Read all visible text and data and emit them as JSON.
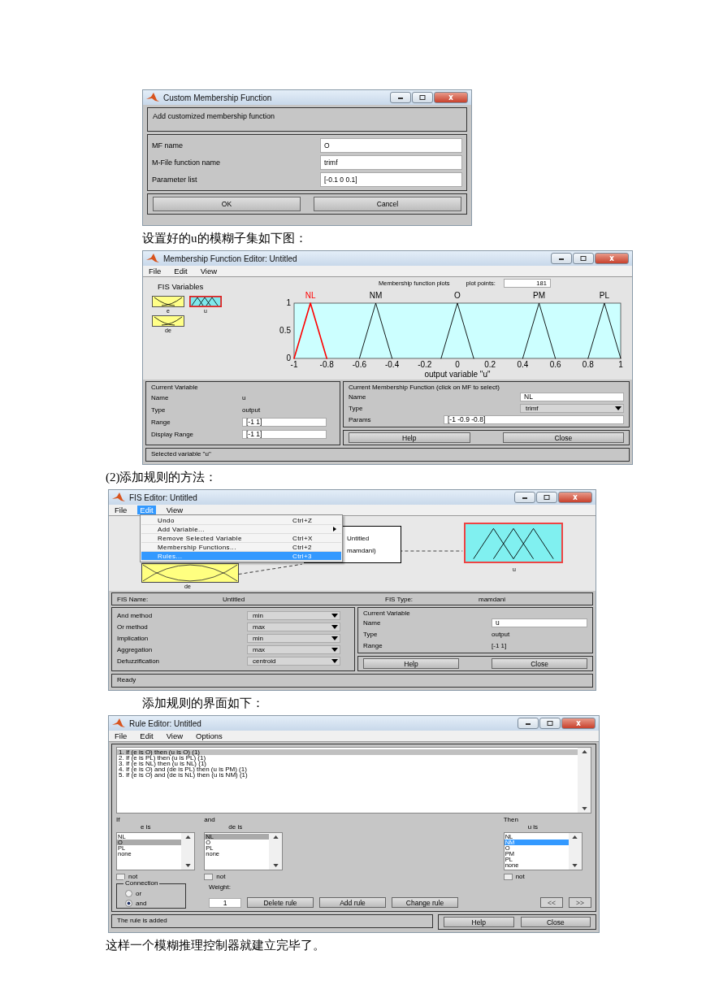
{
  "custom_mf_dialog": {
    "title": "Custom Membership Function",
    "header": "Add customized membership function",
    "fields": [
      {
        "label": "MF name",
        "value": "O"
      },
      {
        "label": "M-File function name",
        "value": "trimf"
      },
      {
        "label": "Parameter list",
        "value": "[-0.1 0 0.1]"
      }
    ],
    "buttons": [
      "OK",
      "Cancel"
    ]
  },
  "caption_1": "设置好的u的模糊子集如下图：",
  "mf_editor": {
    "title": "Membership Function Editor: Untitled",
    "menu": [
      {
        "label": "File",
        "selected": false
      },
      {
        "label": "Edit",
        "selected": false
      },
      {
        "label": "View",
        "selected": false
      }
    ],
    "variables_title": "FIS Variables",
    "variables": [
      {
        "name": "e",
        "kind": "input",
        "selected": false
      },
      {
        "name": "u",
        "kind": "output",
        "selected": true
      },
      {
        "name": "de",
        "kind": "input",
        "selected": false
      }
    ],
    "plot_points_label": "plot points:",
    "plot_points": "181",
    "chart_data": {
      "type": "line",
      "title": "Membership function plots",
      "xlabel": "output variable \"u\"",
      "x": [
        -1,
        -0.9,
        -0.8,
        -0.6,
        -0.5,
        -0.4,
        -0.1,
        0,
        0.1,
        0.4,
        0.5,
        0.6,
        0.8,
        0.9,
        1
      ],
      "series": [
        {
          "name": "NL",
          "color": "#ff0000",
          "values": [
            0,
            1,
            0,
            null,
            null,
            null,
            null,
            null,
            null,
            null,
            null,
            null,
            null,
            null,
            null
          ]
        },
        {
          "name": "NM",
          "color": "#000000",
          "values": [
            null,
            null,
            null,
            0,
            1,
            0,
            null,
            null,
            null,
            null,
            null,
            null,
            null,
            null,
            null
          ]
        },
        {
          "name": "O",
          "color": "#000000",
          "values": [
            null,
            null,
            null,
            null,
            null,
            null,
            0,
            1,
            0,
            null,
            null,
            null,
            null,
            null,
            null
          ]
        },
        {
          "name": "PM",
          "color": "#000000",
          "values": [
            null,
            null,
            null,
            null,
            null,
            null,
            null,
            null,
            null,
            0,
            1,
            0,
            null,
            null,
            null
          ]
        },
        {
          "name": "PL",
          "color": "#000000",
          "values": [
            null,
            null,
            null,
            null,
            null,
            null,
            null,
            null,
            null,
            null,
            null,
            null,
            0,
            1,
            0
          ]
        }
      ],
      "xlim": [
        -1,
        1
      ],
      "ylim": [
        0,
        1
      ],
      "xticks": [
        -1,
        -0.8,
        -0.6,
        -0.4,
        -0.2,
        0,
        0.2,
        0.4,
        0.6,
        0.8,
        1
      ],
      "yticks": [
        0,
        0.5,
        1
      ]
    },
    "current_variable": {
      "title": "Current Variable",
      "rows": [
        {
          "label": "Name",
          "value": "u",
          "kind": "text"
        },
        {
          "label": "Type",
          "value": "output",
          "kind": "text"
        },
        {
          "label": "Range",
          "value": "[-1 1]",
          "kind": "field"
        },
        {
          "label": "Display Range",
          "value": "[-1 1]",
          "kind": "field"
        }
      ]
    },
    "current_mf": {
      "title": "Current Membership Function (click on MF to select)",
      "rows": [
        {
          "label": "Name",
          "value": "NL",
          "kind": "field"
        },
        {
          "label": "Type",
          "value": "trimf",
          "kind": "dropdown"
        },
        {
          "label": "Params",
          "value": "[-1 -0.9 -0.8]",
          "kind": "field"
        }
      ]
    },
    "buttons": [
      "Help",
      "Close"
    ],
    "status": "Selected variable \"u\""
  },
  "caption_2": "(2)添加规则的方法：",
  "fis_editor": {
    "title": "FIS Editor: Untitled",
    "menu": [
      {
        "label": "File",
        "selected": false
      },
      {
        "label": "Edit",
        "selected": true
      },
      {
        "label": "View",
        "selected": false
      }
    ],
    "dropdown": [
      {
        "label": "Undo",
        "shortcut": "Ctrl+Z",
        "submenu": false,
        "selected": false
      },
      {
        "label": "Add Variable...",
        "submenu": true,
        "selected": false
      },
      {
        "label": "Remove Selected Variable",
        "shortcut": "Ctrl+X",
        "submenu": false,
        "selected": false
      },
      {
        "label": "Membership Functions...",
        "shortcut": "Ctrl+2",
        "submenu": false,
        "selected": false
      },
      {
        "label": "Rules...",
        "shortcut": "Ctrl+3",
        "submenu": false,
        "selected": true
      }
    ],
    "input_label": "de",
    "system_lines": [
      "Untitled",
      "mamdani)"
    ],
    "output_label": "u",
    "fis_name_label": "FIS Name:",
    "fis_name": "Untitled",
    "fis_type_label": "FIS Type:",
    "fis_type": "mamdani",
    "methods": [
      {
        "label": "And method",
        "value": "min"
      },
      {
        "label": "Or method",
        "value": "max"
      },
      {
        "label": "Implication",
        "value": "min"
      },
      {
        "label": "Aggregation",
        "value": "max"
      },
      {
        "label": "Defuzzification",
        "value": "centroid"
      }
    ],
    "current_variable": {
      "title": "Current Variable",
      "rows": [
        {
          "label": "Name",
          "value": "u",
          "kind": "field"
        },
        {
          "label": "Type",
          "value": "output",
          "kind": "text"
        },
        {
          "label": "Range",
          "value": "[-1 1]",
          "kind": "text"
        }
      ]
    },
    "buttons": [
      "Help",
      "Close"
    ],
    "status": "Ready"
  },
  "caption_3": "添加规则的界面如下：",
  "rule_editor": {
    "title": "Rule Editor: Untitled",
    "menu": [
      {
        "label": "File",
        "selected": false
      },
      {
        "label": "Edit",
        "selected": false
      },
      {
        "label": "View",
        "selected": false
      },
      {
        "label": "Options",
        "selected": false
      }
    ],
    "rules": [
      {
        "text": "1. If (e is O) then (u is O) (1)",
        "selected": true
      },
      {
        "text": "2. If (e is PL) then (u is PL) (1)",
        "selected": false
      },
      {
        "text": "3. If (e is NL) then (u is NL) (1)",
        "selected": false
      },
      {
        "text": "4. If (e is O) and (de is PL) then (u is PM) (1)",
        "selected": false
      },
      {
        "text": "5. If (e is O) and (de is NL) then (u is NM) (1)",
        "selected": false
      }
    ],
    "lists": [
      {
        "heading": "If",
        "variable": "e is",
        "focused": false,
        "items": [
          {
            "label": "NL",
            "selected": false
          },
          {
            "label": "O",
            "selected": true
          },
          {
            "label": "PL",
            "selected": false
          },
          {
            "label": "none",
            "selected": false
          }
        ],
        "not_label": "not",
        "not_checked": false
      },
      {
        "heading": "and",
        "variable": "de is",
        "focused": false,
        "items": [
          {
            "label": "NL",
            "selected": true
          },
          {
            "label": "O",
            "selected": false
          },
          {
            "label": "PL",
            "selected": false
          },
          {
            "label": "none",
            "selected": false
          }
        ],
        "not_label": "not",
        "not_checked": false
      },
      {
        "heading": "Then",
        "variable": "u is",
        "focused": true,
        "items": [
          {
            "label": "NL",
            "selected": false
          },
          {
            "label": "NM",
            "selected": true
          },
          {
            "label": "O",
            "selected": false
          },
          {
            "label": "PM",
            "selected": false
          },
          {
            "label": "PL",
            "selected": false
          },
          {
            "label": "none",
            "selected": false
          }
        ],
        "not_label": "not",
        "not_checked": false
      }
    ],
    "connection": {
      "title": "Connection",
      "options": [
        {
          "label": "or",
          "selected": false
        },
        {
          "label": "and",
          "selected": true
        }
      ]
    },
    "weight_label": "Weight:",
    "weight": "1",
    "buttons": [
      {
        "label": "Delete rule",
        "disabled": false
      },
      {
        "label": "Add rule",
        "disabled": false
      },
      {
        "label": "Change rule",
        "disabled": false
      }
    ],
    "nav_buttons": [
      {
        "label": "<<",
        "disabled": true
      },
      {
        "label": ">>",
        "disabled": true
      }
    ],
    "status": "The rule is added",
    "bottom_buttons": [
      "Help",
      "Close"
    ]
  },
  "closing_text": "这样一个模糊推理控制器就建立完毕了。"
}
